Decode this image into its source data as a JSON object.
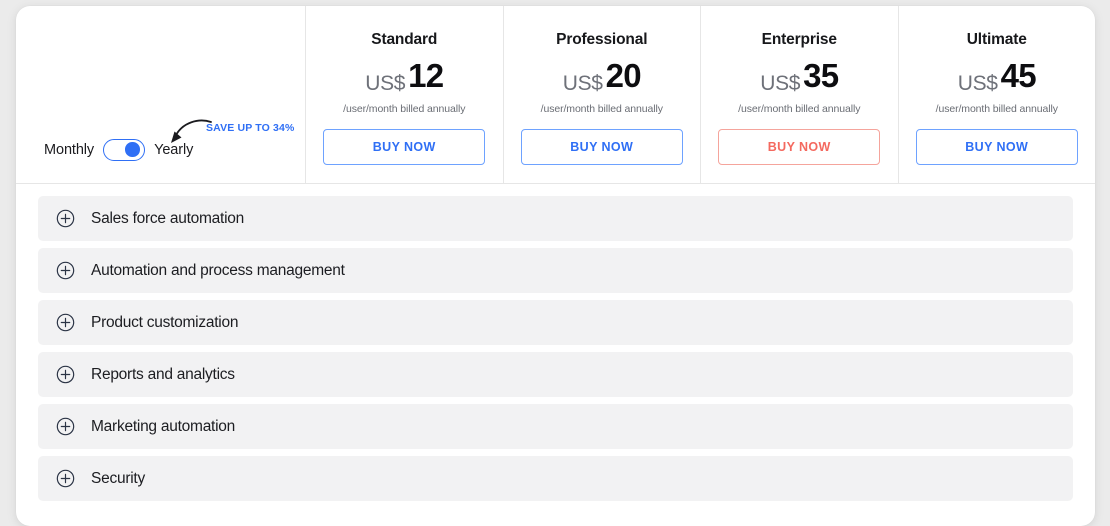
{
  "billing_toggle": {
    "monthly_label": "Monthly",
    "yearly_label": "Yearly",
    "selected": "Yearly",
    "save_badge": "SAVE UP TO 34%",
    "accent_color": "#2f6ff5"
  },
  "plans": [
    {
      "name": "Standard",
      "currency": "US$",
      "price": "12",
      "period": "/user/month billed annually",
      "cta": "BUY NOW",
      "cta_style": "default",
      "cta_color": "#2f6ff5"
    },
    {
      "name": "Professional",
      "currency": "US$",
      "price": "20",
      "period": "/user/month billed annually",
      "cta": "BUY NOW",
      "cta_style": "default",
      "cta_color": "#2f6ff5"
    },
    {
      "name": "Enterprise",
      "currency": "US$",
      "price": "35",
      "period": "/user/month billed annually",
      "cta": "BUY NOW",
      "cta_style": "accent",
      "cta_color": "#f4695f"
    },
    {
      "name": "Ultimate",
      "currency": "US$",
      "price": "45",
      "period": "/user/month billed annually",
      "cta": "BUY NOW",
      "cta_style": "default",
      "cta_color": "#2f6ff5"
    }
  ],
  "feature_sections": [
    {
      "label": "Sales force automation",
      "icon": "plus-circle-icon",
      "expanded": false
    },
    {
      "label": "Automation and process management",
      "icon": "plus-circle-icon",
      "expanded": false
    },
    {
      "label": "Product customization",
      "icon": "plus-circle-icon",
      "expanded": false
    },
    {
      "label": "Reports and analytics",
      "icon": "plus-circle-icon",
      "expanded": false
    },
    {
      "label": "Marketing automation",
      "icon": "plus-circle-icon",
      "expanded": false
    },
    {
      "label": "Security",
      "icon": "plus-circle-icon",
      "expanded": false
    }
  ]
}
